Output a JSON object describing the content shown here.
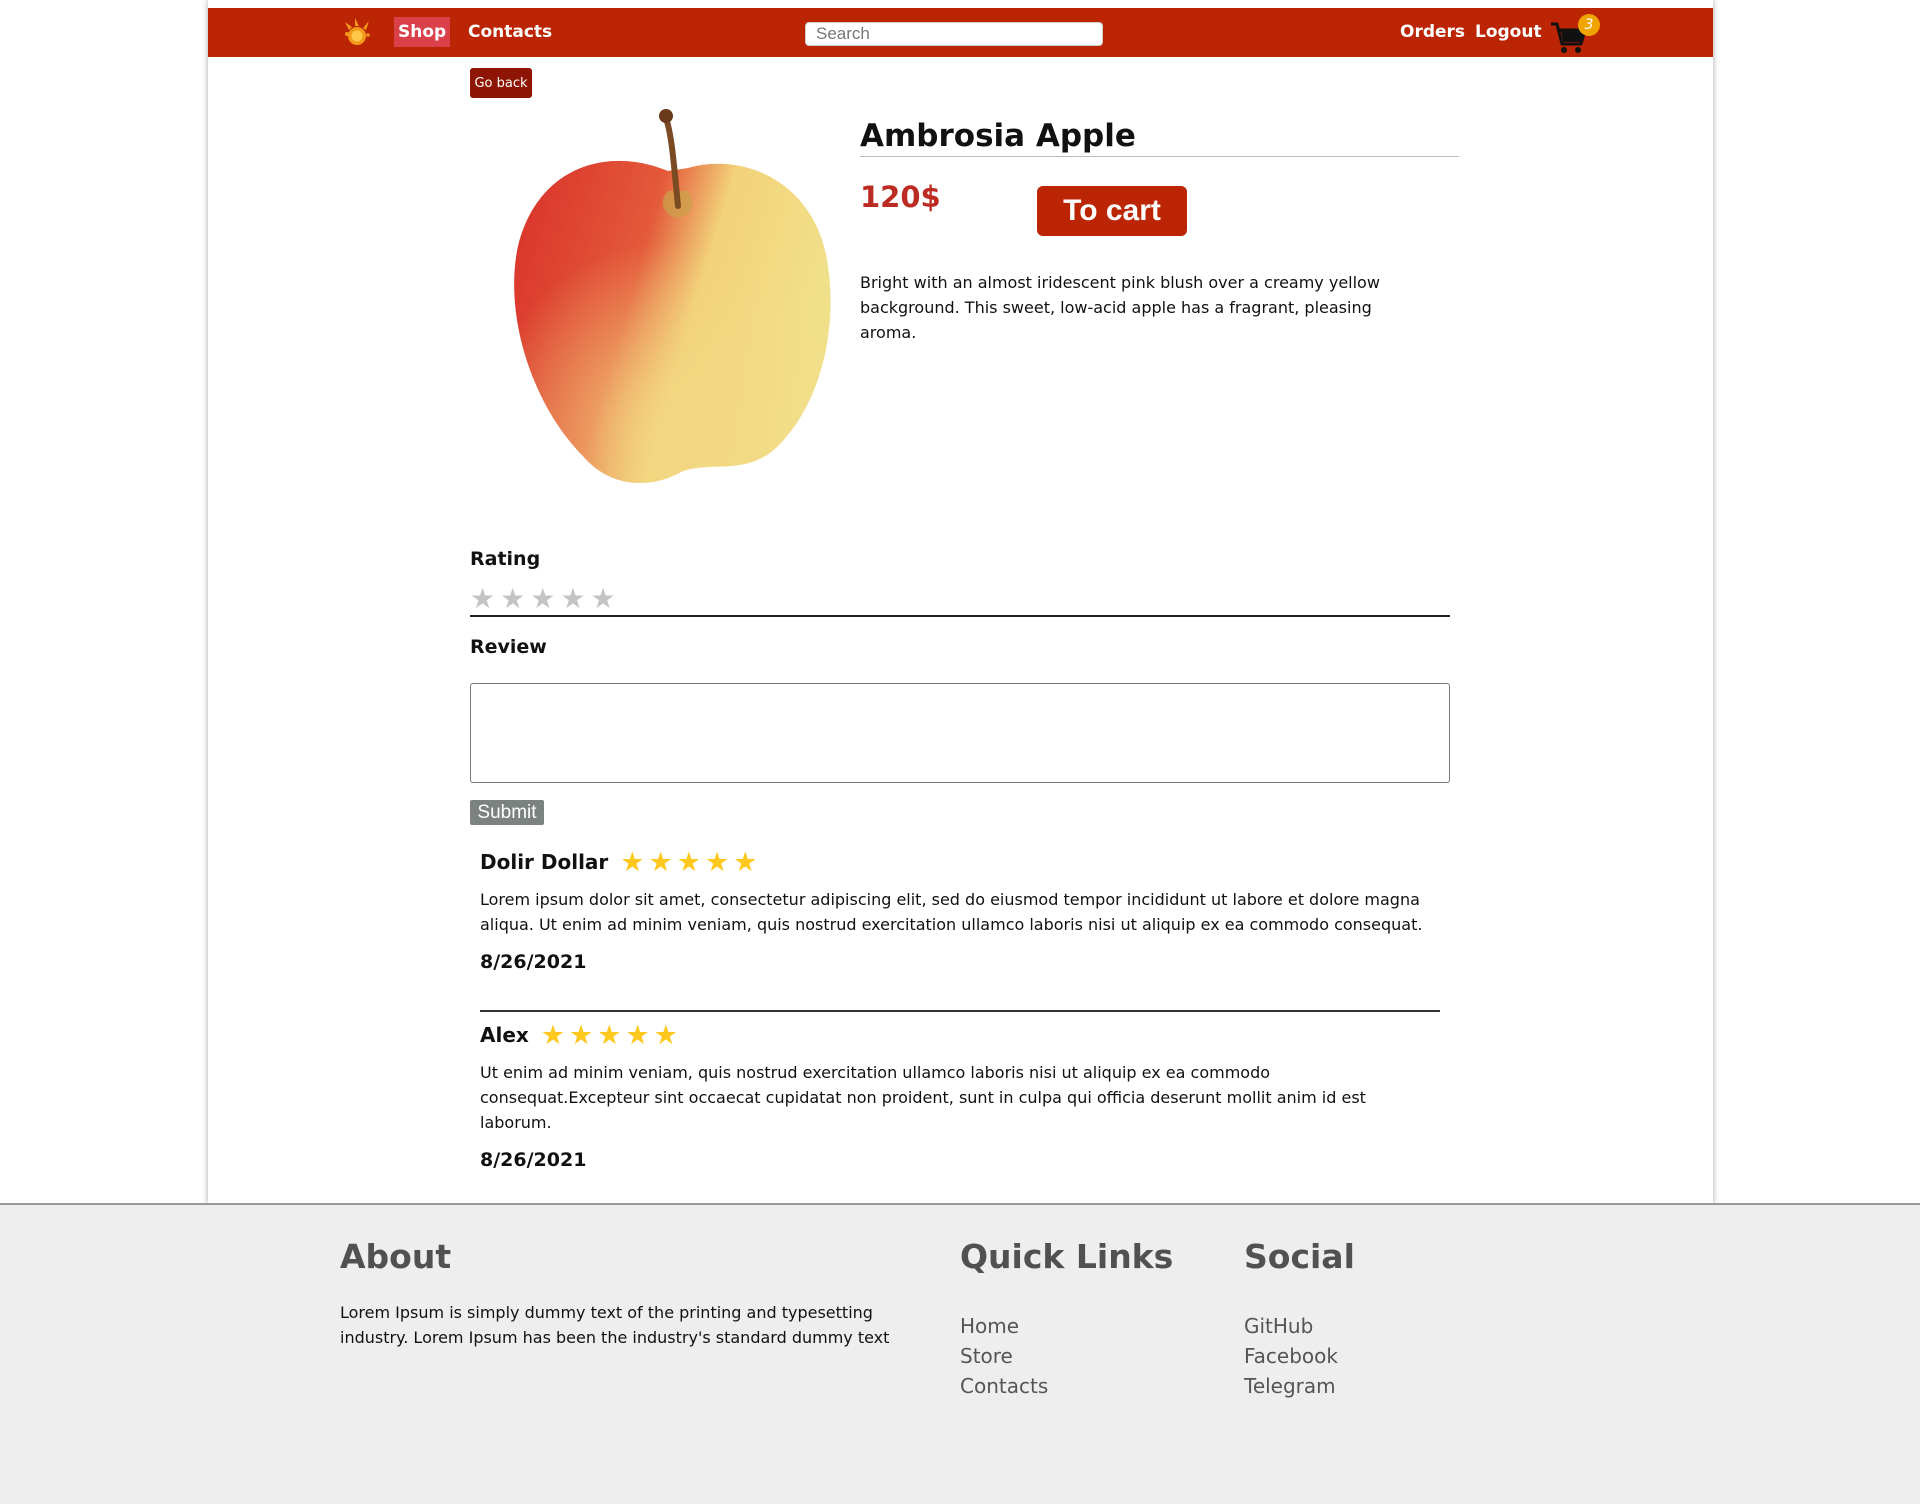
{
  "colors": {
    "brand": "#bb2503",
    "price": "#bb2b21",
    "star_filled": "#ffc81e",
    "star_empty": "#c4c4c4",
    "footer_bg": "#eeeeee"
  },
  "nav": {
    "logo_icon": "fruit-splash-logo-icon",
    "links": [
      "Shop",
      "Contacts"
    ],
    "search_placeholder": "Search",
    "right_links": [
      "Orders",
      "Logout"
    ],
    "cart_icon": "shopping-cart-icon",
    "cart_count": "3"
  },
  "product": {
    "go_back": "Go back",
    "image_icon": "apple-image",
    "title": "Ambrosia Apple",
    "price": "120$",
    "to_cart": "To cart",
    "description": "Bright with an almost iridescent pink blush over a creamy yellow background. This sweet, low-acid apple has a fragrant, pleasing aroma."
  },
  "review_form": {
    "rating_label": "Rating",
    "rating_value": 0,
    "rating_max": 5,
    "review_label": "Review",
    "review_value": "",
    "submit": "Submit"
  },
  "reviews": [
    {
      "name": "Dolir Dollar",
      "stars": 5,
      "text": "Lorem ipsum dolor sit amet, consectetur adipiscing elit, sed do eiusmod tempor incididunt ut labore et dolore magna aliqua. Ut enim ad minim veniam, quis nostrud exercitation ullamco laboris nisi ut aliquip ex ea commodo consequat.",
      "date": "8/26/2021"
    },
    {
      "name": "Alex",
      "stars": 5,
      "text": "Ut enim ad minim veniam, quis nostrud exercitation ullamco laboris nisi ut aliquip ex ea commodo consequat.Excepteur sint occaecat cupidatat non proident, sunt in culpa qui officia deserunt mollit anim id est laborum.",
      "date": "8/26/2021"
    }
  ],
  "footer": {
    "about_title": "About",
    "about_text": "Lorem Ipsum is simply dummy text of the printing and typesetting industry. Lorem Ipsum has been the industry's standard dummy text",
    "quick_links_title": "Quick Links",
    "quick_links": [
      "Home",
      "Store",
      "Contacts"
    ],
    "social_title": "Social",
    "social_links": [
      "GitHub",
      "Facebook",
      "Telegram"
    ]
  }
}
